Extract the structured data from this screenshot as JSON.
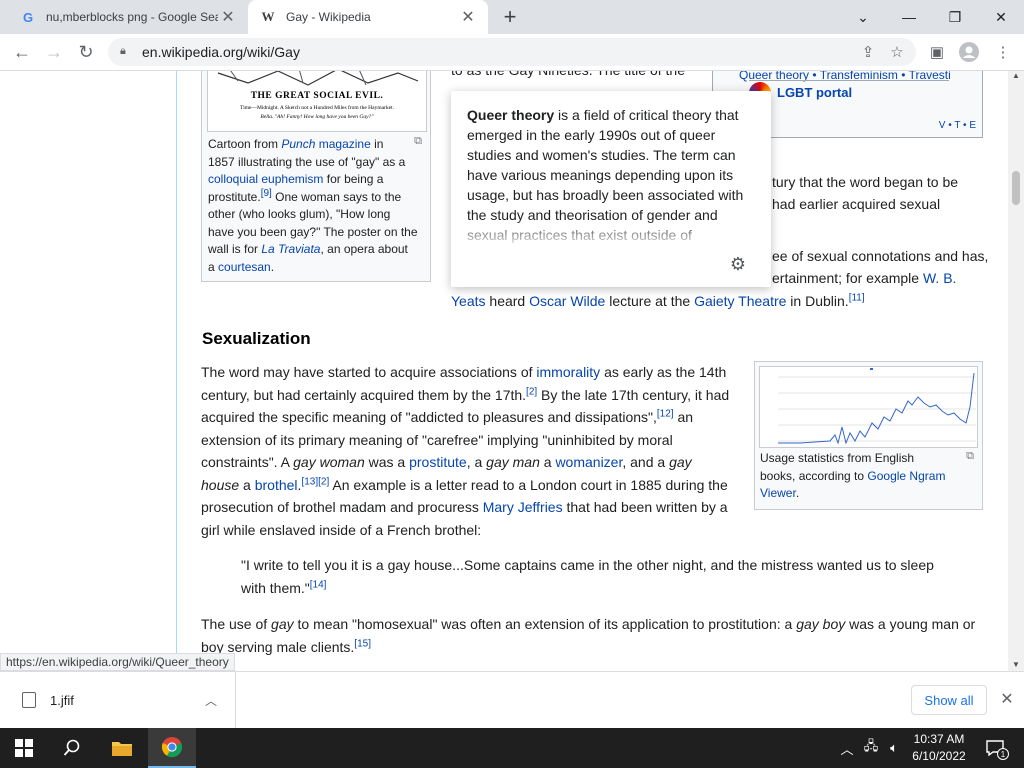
{
  "browser": {
    "tabs": [
      {
        "title": "nu,mberblocks png - Google Sea",
        "favicon": "G"
      },
      {
        "title": "Gay - Wikipedia",
        "favicon": "W"
      }
    ],
    "url": "en.wikipedia.org/wiki/Gay",
    "status_url": "https://en.wikipedia.org/wiki/Queer_theory"
  },
  "article": {
    "top_partial_line": "to as the Gay Nineties. The title of the",
    "navbox": {
      "links_line": "Queer theory • Transfeminism • Travesti",
      "portal": "LGBT portal",
      "vte": "V • T • E"
    },
    "cartoon": {
      "image_heading": "THE GREAT SOCIAL EVIL.",
      "image_line1": "Time—Midnight. A Sketch not a Hundred Miles from the Haymarket.",
      "image_line2": "Bella. \"Ah! Fanny! How long have you been Gay?\"",
      "caption_pre": "Cartoon from ",
      "caption_punch": "Punch",
      "caption_magazine": "magazine",
      "caption_in": " in",
      "caption_year": "1857 illustrating the use of \"gay\" as a",
      "caption_link": "colloquial euphemism",
      "caption_for": " for being a",
      "caption_prostitute": "prostitute.",
      "caption_ref": "[9]",
      "caption_rest1": " One woman says to the",
      "caption_rest2": "other (who looks glum), \"How long",
      "caption_rest3": "have you been gay?\" The poster on the",
      "caption_rest4": "wall is for ",
      "caption_traviata": "La Traviata",
      "caption_rest5": ", an opera about",
      "caption_rest6": "a ",
      "caption_courtesan": "courtesan",
      "caption_end": "."
    },
    "right_fragments": {
      "line1": "tury that the word began to be",
      "line2": "had earlier acquired sexual",
      "line3": "ee of sexual connotations and has,",
      "line4": "ertainment; for example ",
      "wb": "W. B.",
      "yeats": "Yeats",
      "heard": " heard ",
      "wilde": "Oscar Wilde",
      "lecture": " lecture at the ",
      "gaiety": "Gaiety Theatre",
      "dublin": " in Dublin.",
      "ref11": "[11]"
    },
    "section_heading": "Sexualization",
    "ngram": {
      "caption_pre": "Usage statistics from English",
      "caption_mid": "books, according to ",
      "caption_link": "Google Ngram",
      "caption_link2": "Viewer",
      "caption_end": "."
    },
    "para1": {
      "l1a": "The word may have started to acquire associations of ",
      "immorality": "immorality",
      "l1b": " as early as the 14th",
      "l2a": "century, but had certainly acquired them by the 17th.",
      "ref2": "[2]",
      "l2b": " By the late 17th century, it had",
      "l3a": "acquired the specific meaning of \"addicted to pleasures and dissipations\",",
      "ref12": "[12]",
      "l3b": " an",
      "l4": "extension of its primary meaning of \"carefree\" implying \"uninhibited by moral",
      "l5a": "constraints\". A ",
      "gay_woman": "gay woman",
      "l5b": " was a ",
      "prostitute": "prostitute",
      "l5c": ", a ",
      "gay_man": "gay man",
      "l5d": " a ",
      "womanizer": "womanizer",
      "l5e": ", and a ",
      "gay": "gay",
      "house": "house",
      "l6a": " a ",
      "brothel": "brothel",
      "l6b": ".",
      "ref13": "[13][2]",
      "l6c": " An example is a letter read to a London court in 1885 during the",
      "l7a": "prosecution of brothel madam and procuress ",
      "jeffries": "Mary Jeffries",
      "l7b": " that had been written by a",
      "l8": "girl while enslaved inside of a French brothel:"
    },
    "quote": {
      "l1": "\"I write to tell you it is a gay house...Some captains came in the other night, and the mistress wanted us to sleep",
      "l2": "with them.\"",
      "ref14": "[14]"
    },
    "para2": {
      "l1a": "The use of ",
      "gay": "gay",
      "l1b": " to mean \"homosexual\" was often an extension of its application to prostitution: a ",
      "gay_boy": "gay boy",
      "l1c": " was a young man or",
      "l2": "boy serving male clients.",
      "ref15": "[15]"
    },
    "popup": {
      "bold": "Queer theory",
      "text": " is a field of critical theory that emerged in the early 1990s out of queer studies and women's studies. The term can have various meanings depending upon its usage, but has broadly been associated with the study and theorisation of gender and sexual practices that exist outside of"
    }
  },
  "download_shelf": {
    "file": "1.jfif",
    "show_all": "Show all"
  },
  "taskbar": {
    "time": "10:37 AM",
    "date": "6/10/2022",
    "notification_count": "1"
  }
}
